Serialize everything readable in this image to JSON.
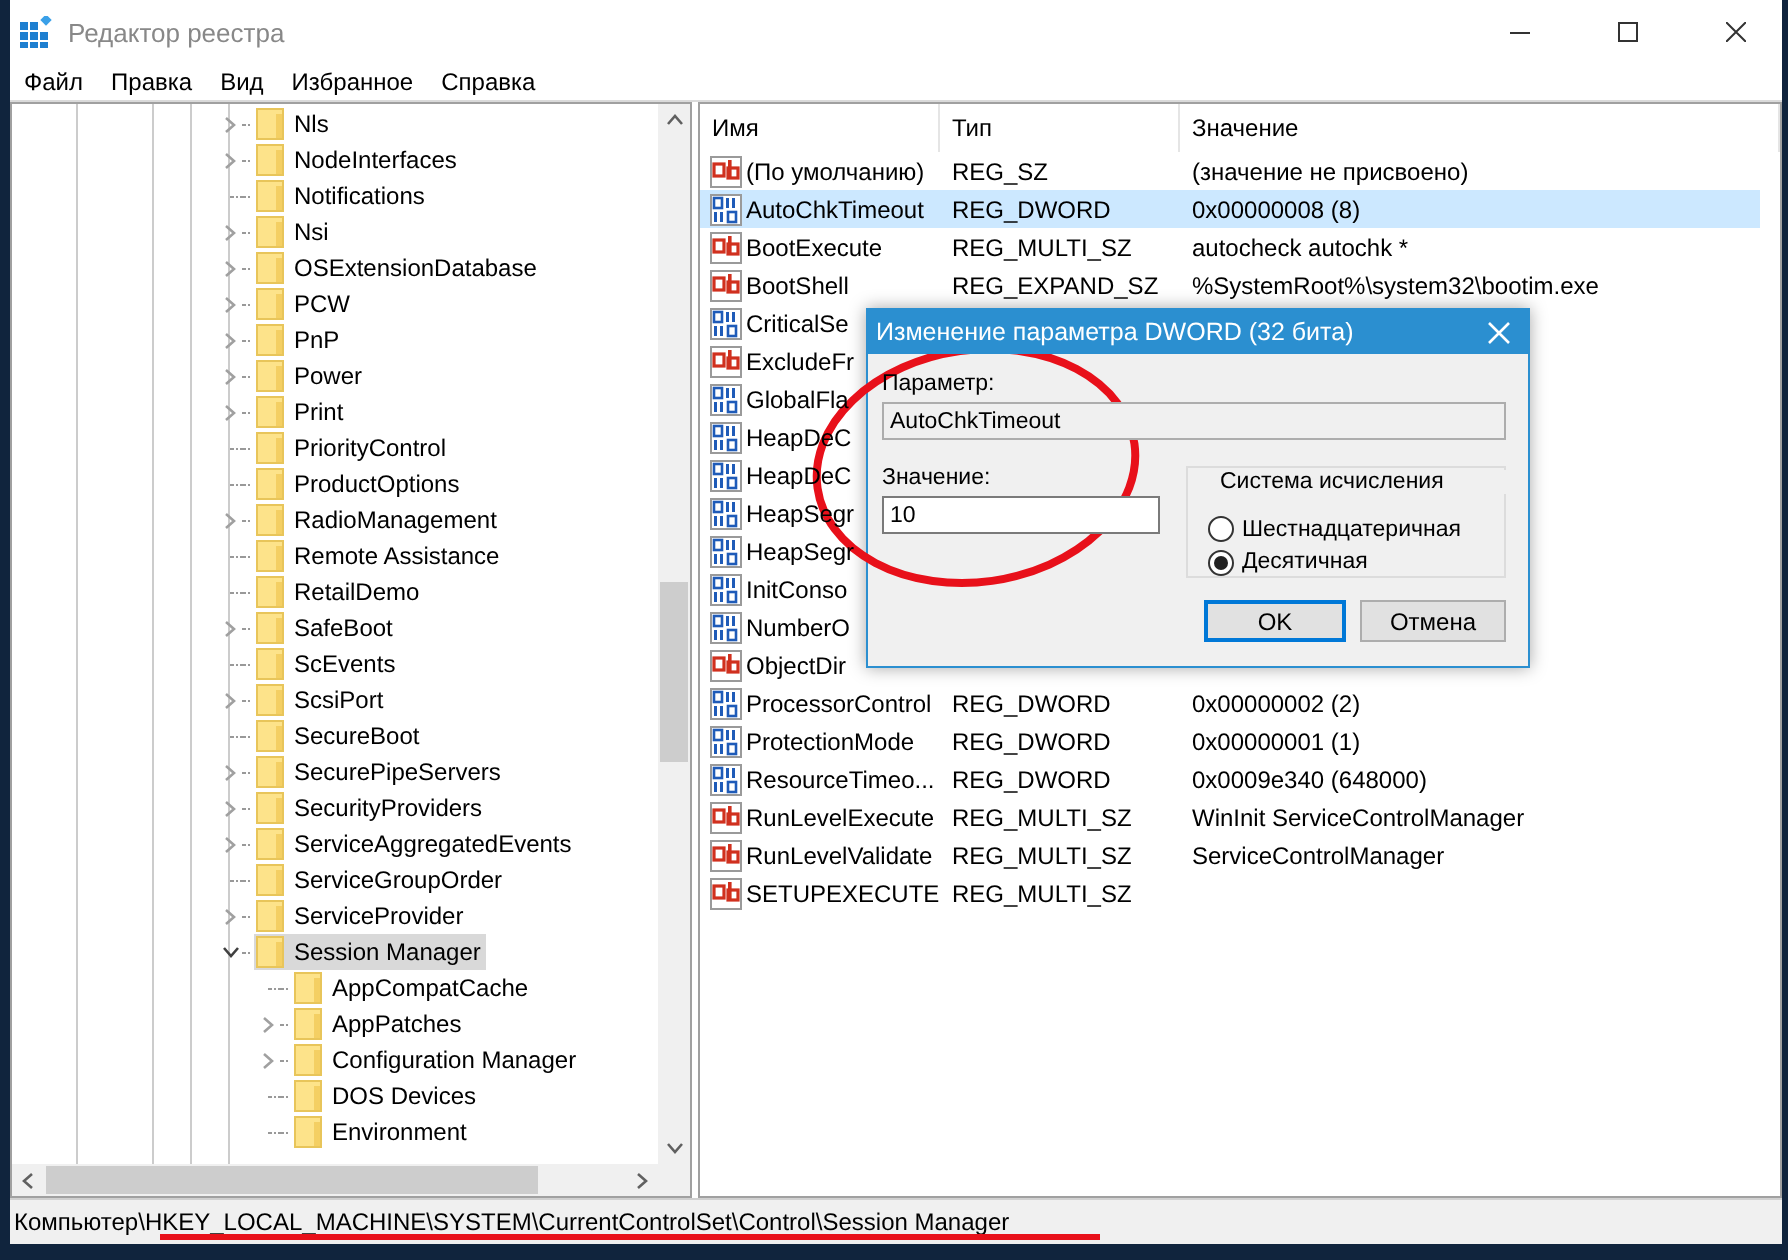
{
  "window": {
    "title": "Редактор реестра"
  },
  "menu": [
    "Файл",
    "Правка",
    "Вид",
    "Избранное",
    "Справка"
  ],
  "tree": {
    "items": [
      {
        "label": "Nls",
        "kind": "collapsed",
        "selected": false
      },
      {
        "label": "NodeInterfaces",
        "kind": "collapsed",
        "selected": false
      },
      {
        "label": "Notifications",
        "kind": "leaf",
        "selected": false
      },
      {
        "label": "Nsi",
        "kind": "collapsed",
        "selected": false
      },
      {
        "label": "OSExtensionDatabase",
        "kind": "collapsed",
        "selected": false
      },
      {
        "label": "PCW",
        "kind": "collapsed",
        "selected": false
      },
      {
        "label": "PnP",
        "kind": "collapsed",
        "selected": false
      },
      {
        "label": "Power",
        "kind": "collapsed",
        "selected": false
      },
      {
        "label": "Print",
        "kind": "collapsed",
        "selected": false
      },
      {
        "label": "PriorityControl",
        "kind": "leaf",
        "selected": false
      },
      {
        "label": "ProductOptions",
        "kind": "leaf",
        "selected": false
      },
      {
        "label": "RadioManagement",
        "kind": "collapsed",
        "selected": false
      },
      {
        "label": "Remote Assistance",
        "kind": "leaf",
        "selected": false
      },
      {
        "label": "RetailDemo",
        "kind": "leaf",
        "selected": false
      },
      {
        "label": "SafeBoot",
        "kind": "collapsed",
        "selected": false
      },
      {
        "label": "ScEvents",
        "kind": "leaf",
        "selected": false
      },
      {
        "label": "ScsiPort",
        "kind": "collapsed",
        "selected": false
      },
      {
        "label": "SecureBoot",
        "kind": "leaf",
        "selected": false
      },
      {
        "label": "SecurePipeServers",
        "kind": "collapsed",
        "selected": false
      },
      {
        "label": "SecurityProviders",
        "kind": "collapsed",
        "selected": false
      },
      {
        "label": "ServiceAggregatedEvents",
        "kind": "collapsed",
        "selected": false
      },
      {
        "label": "ServiceGroupOrder",
        "kind": "leaf",
        "selected": false
      },
      {
        "label": "ServiceProvider",
        "kind": "collapsed",
        "selected": false
      },
      {
        "label": "Session Manager",
        "kind": "expanded",
        "selected": true,
        "children": [
          {
            "label": "AppCompatCache",
            "kind": "leaf",
            "selected": false
          },
          {
            "label": "AppPatches",
            "kind": "collapsed",
            "selected": false
          },
          {
            "label": "Configuration Manager",
            "kind": "collapsed",
            "selected": false
          },
          {
            "label": "DOS Devices",
            "kind": "leaf",
            "selected": false
          },
          {
            "label": "Environment",
            "kind": "leaf",
            "selected": false
          }
        ]
      }
    ]
  },
  "list": {
    "columns": [
      "Имя",
      "Тип",
      "Значение"
    ],
    "rows": [
      {
        "kind": "string",
        "name": "(По умолчанию)",
        "type": "REG_SZ",
        "value": "(значение не присвоено)",
        "selected": false
      },
      {
        "kind": "binary",
        "name": "AutoChkTimeout",
        "type": "REG_DWORD",
        "value": "0x00000008 (8)",
        "selected": true
      },
      {
        "kind": "string",
        "name": "BootExecute",
        "type": "REG_MULTI_SZ",
        "value": "autocheck autochk *",
        "selected": false
      },
      {
        "kind": "string",
        "name": "BootShell",
        "type": "REG_EXPAND_SZ",
        "value": "%SystemRoot%\\system32\\bootim.exe",
        "selected": false
      },
      {
        "kind": "binary",
        "name": "CriticalSe",
        "selected": false
      },
      {
        "kind": "string",
        "name": "ExcludeFr",
        "selected": false
      },
      {
        "kind": "binary",
        "name": "GlobalFla",
        "selected": false
      },
      {
        "kind": "binary",
        "name": "HeapDeC",
        "selected": false
      },
      {
        "kind": "binary",
        "name": "HeapDeC",
        "selected": false
      },
      {
        "kind": "binary",
        "name": "HeapSegr",
        "selected": false
      },
      {
        "kind": "binary",
        "name": "HeapSegr",
        "selected": false
      },
      {
        "kind": "binary",
        "name": "InitConso",
        "selected": false
      },
      {
        "kind": "binary",
        "name": "NumberO",
        "selected": false
      },
      {
        "kind": "string",
        "name": "ObjectDir",
        "selected": false
      },
      {
        "kind": "binary",
        "name": "ProcessorControl",
        "type": "REG_DWORD",
        "value": "0x00000002 (2)",
        "selected": false
      },
      {
        "kind": "binary",
        "name": "ProtectionMode",
        "type": "REG_DWORD",
        "value": "0x00000001 (1)",
        "selected": false
      },
      {
        "kind": "binary",
        "name": "ResourceTimeo...",
        "type": "REG_DWORD",
        "value": "0x0009e340 (648000)",
        "selected": false
      },
      {
        "kind": "string",
        "name": "RunLevelExecute",
        "type": "REG_MULTI_SZ",
        "value": "WinInit ServiceControlManager",
        "selected": false
      },
      {
        "kind": "string",
        "name": "RunLevelValidate",
        "type": "REG_MULTI_SZ",
        "value": "ServiceControlManager",
        "selected": false
      },
      {
        "kind": "string",
        "name": "SETUPEXECUTE",
        "type": "REG_MULTI_SZ",
        "selected": false
      }
    ]
  },
  "dialog": {
    "title": "Изменение параметра DWORD (32 бита)",
    "name_label": "Параметр:",
    "name_value": "AutoChkTimeout",
    "value_label": "Значение:",
    "value": "10",
    "base_group": {
      "title": "Система исчисления",
      "options": [
        {
          "label": "Шестнадцатеричная",
          "selected": false
        },
        {
          "label": "Десятичная",
          "selected": true
        }
      ]
    },
    "buttons": [
      {
        "label": "OK",
        "default": true
      },
      {
        "label": "Отмена",
        "default": false
      }
    ]
  },
  "status_bar": "Компьютер\\HKEY_LOCAL_MACHINE\\SYSTEM\\CurrentControlSet\\Control\\Session Manager"
}
